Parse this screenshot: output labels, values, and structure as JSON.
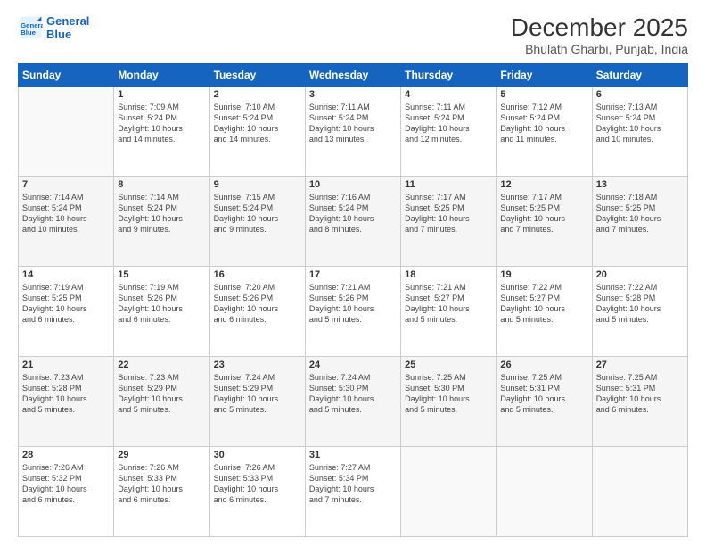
{
  "header": {
    "logo_line1": "General",
    "logo_line2": "Blue",
    "title": "December 2025",
    "subtitle": "Bhulath Gharbi, Punjab, India"
  },
  "weekdays": [
    "Sunday",
    "Monday",
    "Tuesday",
    "Wednesday",
    "Thursday",
    "Friday",
    "Saturday"
  ],
  "weeks": [
    [
      {
        "day": "",
        "info": ""
      },
      {
        "day": "1",
        "info": "Sunrise: 7:09 AM\nSunset: 5:24 PM\nDaylight: 10 hours\nand 14 minutes."
      },
      {
        "day": "2",
        "info": "Sunrise: 7:10 AM\nSunset: 5:24 PM\nDaylight: 10 hours\nand 14 minutes."
      },
      {
        "day": "3",
        "info": "Sunrise: 7:11 AM\nSunset: 5:24 PM\nDaylight: 10 hours\nand 13 minutes."
      },
      {
        "day": "4",
        "info": "Sunrise: 7:11 AM\nSunset: 5:24 PM\nDaylight: 10 hours\nand 12 minutes."
      },
      {
        "day": "5",
        "info": "Sunrise: 7:12 AM\nSunset: 5:24 PM\nDaylight: 10 hours\nand 11 minutes."
      },
      {
        "day": "6",
        "info": "Sunrise: 7:13 AM\nSunset: 5:24 PM\nDaylight: 10 hours\nand 10 minutes."
      }
    ],
    [
      {
        "day": "7",
        "info": "Sunrise: 7:14 AM\nSunset: 5:24 PM\nDaylight: 10 hours\nand 10 minutes."
      },
      {
        "day": "8",
        "info": "Sunrise: 7:14 AM\nSunset: 5:24 PM\nDaylight: 10 hours\nand 9 minutes."
      },
      {
        "day": "9",
        "info": "Sunrise: 7:15 AM\nSunset: 5:24 PM\nDaylight: 10 hours\nand 9 minutes."
      },
      {
        "day": "10",
        "info": "Sunrise: 7:16 AM\nSunset: 5:24 PM\nDaylight: 10 hours\nand 8 minutes."
      },
      {
        "day": "11",
        "info": "Sunrise: 7:17 AM\nSunset: 5:25 PM\nDaylight: 10 hours\nand 7 minutes."
      },
      {
        "day": "12",
        "info": "Sunrise: 7:17 AM\nSunset: 5:25 PM\nDaylight: 10 hours\nand 7 minutes."
      },
      {
        "day": "13",
        "info": "Sunrise: 7:18 AM\nSunset: 5:25 PM\nDaylight: 10 hours\nand 7 minutes."
      }
    ],
    [
      {
        "day": "14",
        "info": "Sunrise: 7:19 AM\nSunset: 5:25 PM\nDaylight: 10 hours\nand 6 minutes."
      },
      {
        "day": "15",
        "info": "Sunrise: 7:19 AM\nSunset: 5:26 PM\nDaylight: 10 hours\nand 6 minutes."
      },
      {
        "day": "16",
        "info": "Sunrise: 7:20 AM\nSunset: 5:26 PM\nDaylight: 10 hours\nand 6 minutes."
      },
      {
        "day": "17",
        "info": "Sunrise: 7:21 AM\nSunset: 5:26 PM\nDaylight: 10 hours\nand 5 minutes."
      },
      {
        "day": "18",
        "info": "Sunrise: 7:21 AM\nSunset: 5:27 PM\nDaylight: 10 hours\nand 5 minutes."
      },
      {
        "day": "19",
        "info": "Sunrise: 7:22 AM\nSunset: 5:27 PM\nDaylight: 10 hours\nand 5 minutes."
      },
      {
        "day": "20",
        "info": "Sunrise: 7:22 AM\nSunset: 5:28 PM\nDaylight: 10 hours\nand 5 minutes."
      }
    ],
    [
      {
        "day": "21",
        "info": "Sunrise: 7:23 AM\nSunset: 5:28 PM\nDaylight: 10 hours\nand 5 minutes."
      },
      {
        "day": "22",
        "info": "Sunrise: 7:23 AM\nSunset: 5:29 PM\nDaylight: 10 hours\nand 5 minutes."
      },
      {
        "day": "23",
        "info": "Sunrise: 7:24 AM\nSunset: 5:29 PM\nDaylight: 10 hours\nand 5 minutes."
      },
      {
        "day": "24",
        "info": "Sunrise: 7:24 AM\nSunset: 5:30 PM\nDaylight: 10 hours\nand 5 minutes."
      },
      {
        "day": "25",
        "info": "Sunrise: 7:25 AM\nSunset: 5:30 PM\nDaylight: 10 hours\nand 5 minutes."
      },
      {
        "day": "26",
        "info": "Sunrise: 7:25 AM\nSunset: 5:31 PM\nDaylight: 10 hours\nand 5 minutes."
      },
      {
        "day": "27",
        "info": "Sunrise: 7:25 AM\nSunset: 5:31 PM\nDaylight: 10 hours\nand 6 minutes."
      }
    ],
    [
      {
        "day": "28",
        "info": "Sunrise: 7:26 AM\nSunset: 5:32 PM\nDaylight: 10 hours\nand 6 minutes."
      },
      {
        "day": "29",
        "info": "Sunrise: 7:26 AM\nSunset: 5:33 PM\nDaylight: 10 hours\nand 6 minutes."
      },
      {
        "day": "30",
        "info": "Sunrise: 7:26 AM\nSunset: 5:33 PM\nDaylight: 10 hours\nand 6 minutes."
      },
      {
        "day": "31",
        "info": "Sunrise: 7:27 AM\nSunset: 5:34 PM\nDaylight: 10 hours\nand 7 minutes."
      },
      {
        "day": "",
        "info": ""
      },
      {
        "day": "",
        "info": ""
      },
      {
        "day": "",
        "info": ""
      }
    ]
  ]
}
